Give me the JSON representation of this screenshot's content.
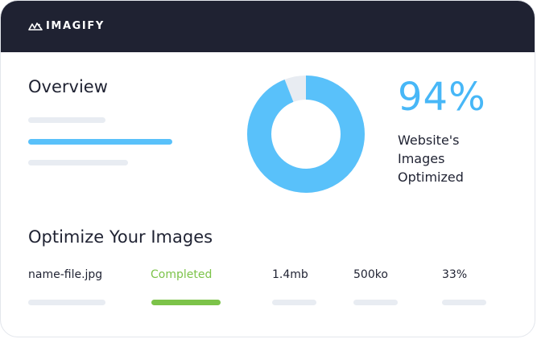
{
  "header": {
    "brand": "IMAGIFY",
    "logo_icon": "imagify-logo-icon",
    "background": "#1f2232"
  },
  "overview": {
    "title": "Overview",
    "optimized_percent": 94,
    "percent_text": "94%",
    "percent_label_lines": [
      "Website's",
      "Images",
      "Optimized"
    ],
    "donut_color": "#59c1fa",
    "donut_remainder_color": "#e8ecf2"
  },
  "optimize": {
    "title": "Optimize Your Images",
    "row": {
      "file_name": "name-file.jpg",
      "status": "Completed",
      "original_size": "1.4mb",
      "optimized_size": "500ko",
      "savings": "33%"
    },
    "status_color": "#7cc349"
  }
}
